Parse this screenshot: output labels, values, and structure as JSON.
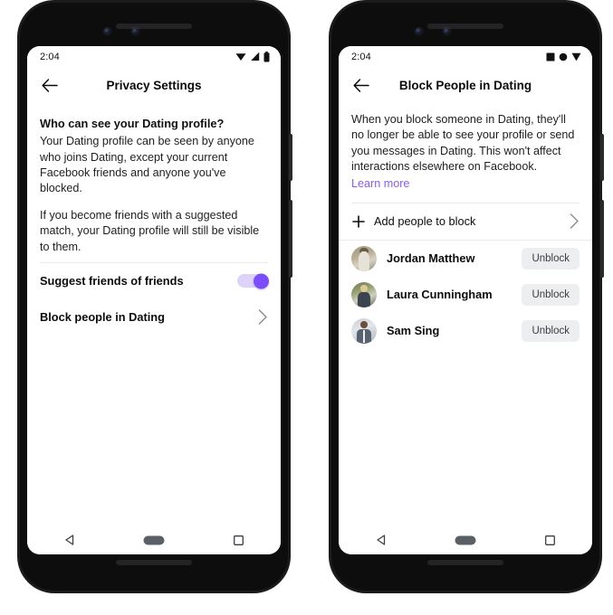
{
  "phones": [
    {
      "id": "privacy-settings",
      "status": {
        "time": "2:04",
        "icons": [
          "wifi-icon",
          "cellular-signal-icon",
          "battery-icon"
        ]
      },
      "appbar": {
        "back_icon": "back-arrow-icon",
        "title": "Privacy Settings"
      },
      "body": {
        "heading": "Who can see your Dating profile?",
        "paragraph1": "Your Dating profile can be seen by anyone who joins Dating, except your current Facebook friends and anyone you've blocked.",
        "paragraph2": "If you become friends with a suggested match, your Dating profile will still be visible to them."
      },
      "settings_rows": [
        {
          "label": "Suggest friends of friends",
          "control": "toggle",
          "state": "on",
          "name": "suggest-friends-of-friends"
        },
        {
          "label": "Block people in Dating",
          "control": "chevron",
          "name": "block-people-in-dating"
        }
      ],
      "navbar": {
        "back": "nav-back-icon",
        "home": "nav-home-icon",
        "recents": "nav-recents-icon"
      }
    },
    {
      "id": "block-people",
      "status": {
        "time": "2:04",
        "icons": [
          "square-icon",
          "circle-icon",
          "triangle-icon"
        ]
      },
      "appbar": {
        "back_icon": "back-arrow-icon",
        "title": "Block People in Dating"
      },
      "body": {
        "paragraph1": "When you block someone in Dating, they'll no longer be able to see your profile or send you messages in Dating. This won't affect interactions elsewhere on Facebook.",
        "learn_more": "Learn more"
      },
      "add_row": {
        "label": "Add people to block",
        "plus_icon": "plus-icon",
        "chevron_icon": "chevron-right-icon"
      },
      "people": [
        {
          "name": "Jordan Matthew",
          "action": "Unblock",
          "avatar": "avatar-jordan-matthew"
        },
        {
          "name": "Laura Cunningham",
          "action": "Unblock",
          "avatar": "avatar-laura-cunningham"
        },
        {
          "name": "Sam Sing",
          "action": "Unblock",
          "avatar": "avatar-sam-sing"
        }
      ],
      "navbar": {
        "back": "nav-back-icon",
        "home": "nav-home-icon",
        "recents": "nav-recents-icon"
      }
    }
  ],
  "colors": {
    "accent_purple": "#7c4dff",
    "link_purple": "#8b5cf6",
    "toggle_track": "#ddd2f7",
    "button_bg": "#eceef0",
    "divider": "#e8e9ea",
    "text_primary": "#0c0c0c",
    "device_body": "#0d0d0e"
  }
}
